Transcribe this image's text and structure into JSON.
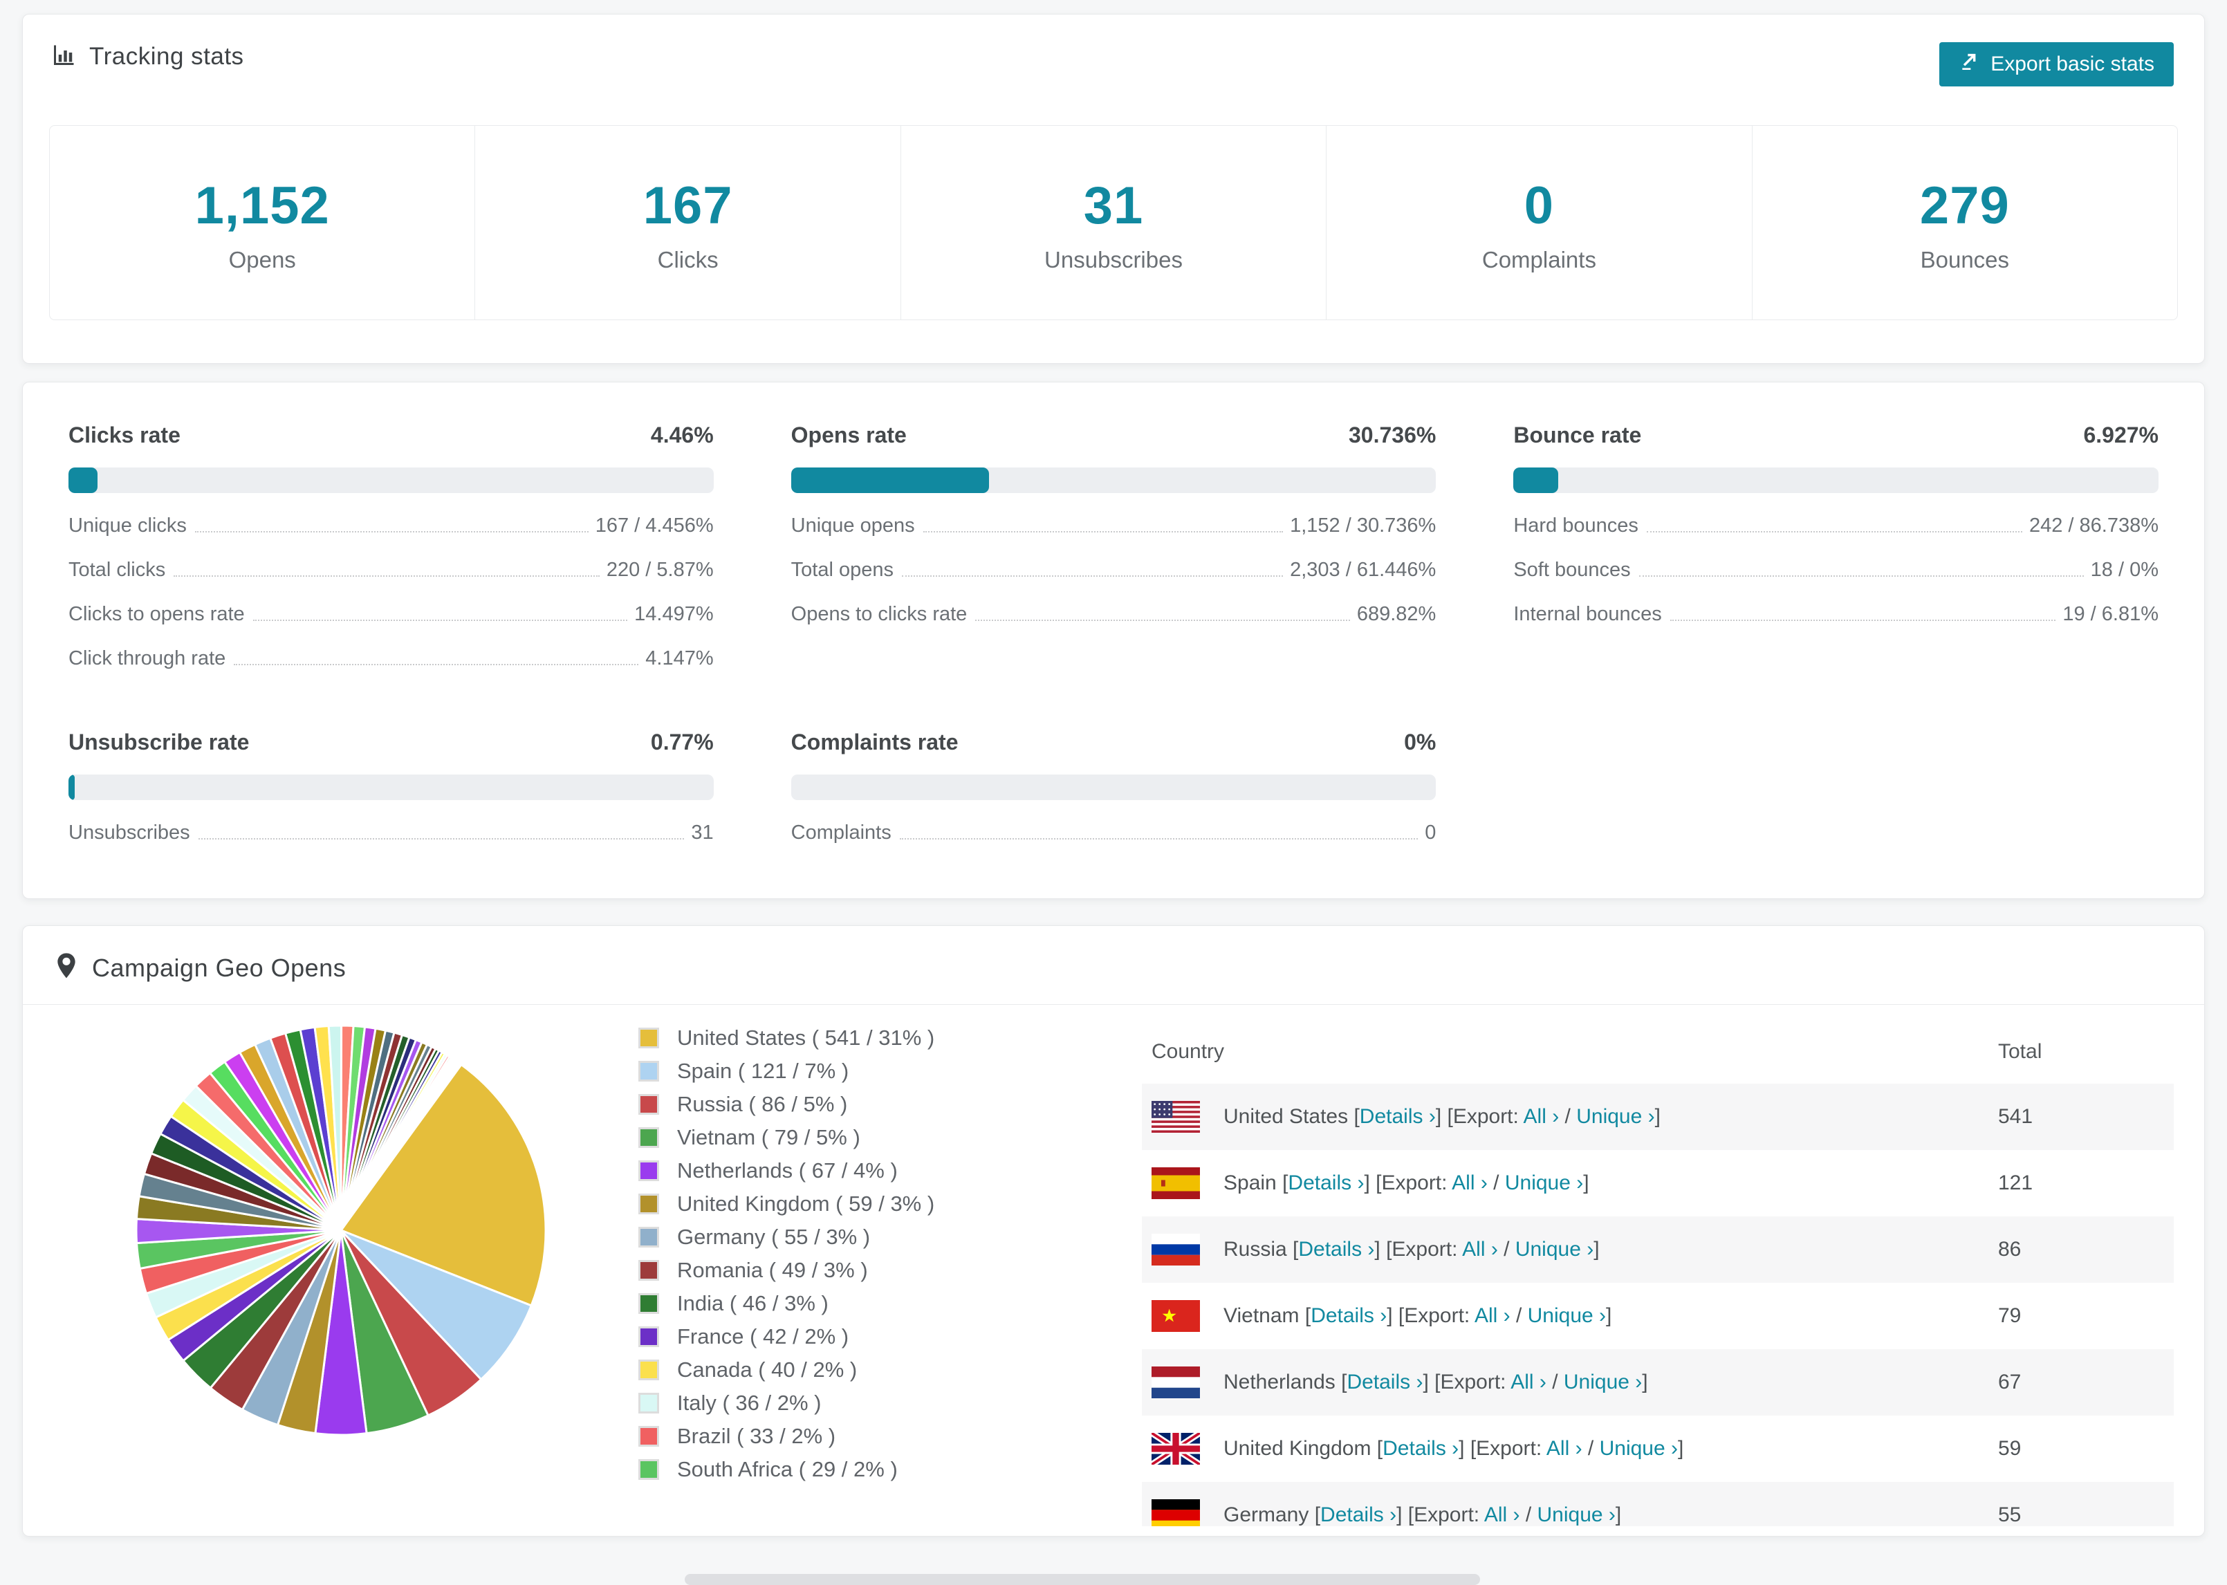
{
  "accent_color": "#1189a0",
  "header": {
    "title": "Tracking stats",
    "title_icon": "bar-chart-icon",
    "export_button": "Export basic stats",
    "export_button_icon": "export-icon"
  },
  "summary_stats": [
    {
      "value": "1,152",
      "label": "Opens"
    },
    {
      "value": "167",
      "label": "Clicks"
    },
    {
      "value": "31",
      "label": "Unsubscribes"
    },
    {
      "value": "0",
      "label": "Complaints"
    },
    {
      "value": "279",
      "label": "Bounces"
    }
  ],
  "rate_panels": [
    {
      "title": "Clicks rate",
      "value": "4.46%",
      "progress_pct": 4.46,
      "rows": [
        {
          "label": "Unique clicks",
          "value": "167 / 4.456%"
        },
        {
          "label": "Total clicks",
          "value": "220 / 5.87%"
        },
        {
          "label": "Clicks to opens rate",
          "value": "14.497%"
        },
        {
          "label": "Click through rate",
          "value": "4.147%"
        }
      ]
    },
    {
      "title": "Opens rate",
      "value": "30.736%",
      "progress_pct": 30.736,
      "rows": [
        {
          "label": "Unique opens",
          "value": "1,152 / 30.736%"
        },
        {
          "label": "Total opens",
          "value": "2,303 / 61.446%"
        },
        {
          "label": "Opens to clicks rate",
          "value": "689.82%"
        }
      ]
    },
    {
      "title": "Bounce rate",
      "value": "6.927%",
      "progress_pct": 6.927,
      "rows": [
        {
          "label": "Hard bounces",
          "value": "242 / 86.738%"
        },
        {
          "label": "Soft bounces",
          "value": "18 / 0%"
        },
        {
          "label": "Internal bounces",
          "value": "19 / 6.81%"
        }
      ]
    },
    {
      "title": "Unsubscribe rate",
      "value": "0.77%",
      "progress_pct": 0.77,
      "rows": [
        {
          "label": "Unsubscribes",
          "value": "31"
        }
      ]
    },
    {
      "title": "Complaints rate",
      "value": "0%",
      "progress_pct": 0,
      "rows": [
        {
          "label": "Complaints",
          "value": "0"
        }
      ]
    }
  ],
  "geo": {
    "title": "Campaign Geo Opens",
    "title_icon": "map-pin-icon",
    "chart_data": {
      "type": "pie",
      "title": "Campaign Geo Opens",
      "legend_position": "right",
      "start_angle_deg": -90,
      "direction": "clockwise",
      "categories": [
        "United States",
        "Spain",
        "Russia",
        "Vietnam",
        "Netherlands",
        "United Kingdom",
        "Germany",
        "Romania",
        "India",
        "France",
        "Canada",
        "Italy",
        "Brazil",
        "South Africa"
      ],
      "values": [
        541,
        121,
        86,
        79,
        67,
        59,
        55,
        49,
        46,
        42,
        40,
        36,
        33,
        29
      ],
      "percentages": [
        31,
        7,
        5,
        5,
        4,
        3,
        3,
        3,
        3,
        2,
        2,
        2,
        2,
        2
      ],
      "colors": [
        "#e5be3b",
        "#aed3f1",
        "#c8494b",
        "#4ca64f",
        "#9a3bee",
        "#b2912b",
        "#90b0cb",
        "#9d3b3b",
        "#2f7d33",
        "#6c2fc7",
        "#fbe04d",
        "#d9f8f5",
        "#f06061",
        "#5ac561"
      ],
      "others_unlabeled_pct": 36,
      "legend_format": "{name} ( {value} / {pct}% )"
    },
    "table": {
      "columns": [
        "Country",
        "Total"
      ],
      "link_text": {
        "details": "Details ›",
        "export_prefix": "Export:",
        "all": "All ›",
        "unique": "Unique ›"
      },
      "rows": [
        {
          "country": "United States",
          "flag": "us",
          "total": "541"
        },
        {
          "country": "Spain",
          "flag": "es",
          "total": "121"
        },
        {
          "country": "Russia",
          "flag": "ru",
          "total": "86"
        },
        {
          "country": "Vietnam",
          "flag": "vn",
          "total": "79"
        },
        {
          "country": "Netherlands",
          "flag": "nl",
          "total": "67"
        },
        {
          "country": "United Kingdom",
          "flag": "gb",
          "total": "59"
        },
        {
          "country": "Germany",
          "flag": "de",
          "total": "55"
        }
      ]
    }
  }
}
